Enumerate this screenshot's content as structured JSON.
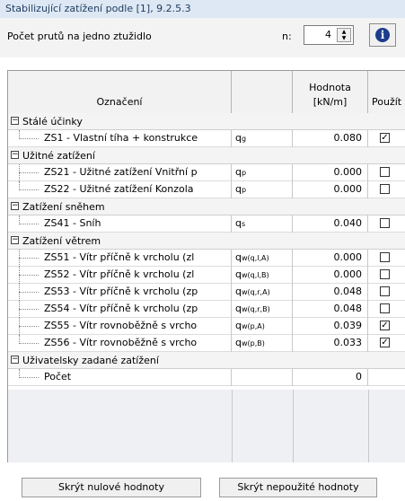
{
  "header": {
    "title": "Stabilizující zatížení podle [1], 9.2.5.3"
  },
  "params": {
    "rods_label": "Počet prutů na jedno ztužidlo",
    "n_label": "n:",
    "n_value": "4",
    "info_icon": "i"
  },
  "columns": {
    "name": "Označení",
    "value_line1": "Hodnota",
    "value_line2": "[kN/m]",
    "use": "Použít"
  },
  "groups": [
    {
      "label": "Stálé účinky",
      "items": [
        {
          "name": "ZS1 - Vlastní tíha + konstrukce",
          "sym": "q",
          "sub": "g",
          "value": "0.080",
          "checked": true
        }
      ]
    },
    {
      "label": "Užitné zatížení",
      "items": [
        {
          "name": "ZS21 - Užitné zatížení Vnitřní p",
          "sym": "q",
          "sub": "p",
          "value": "0.000",
          "checked": false
        },
        {
          "name": "ZS22 - Užitné zatížení Konzola",
          "sym": "q",
          "sub": "p",
          "value": "0.000",
          "checked": false
        }
      ]
    },
    {
      "label": "Zatížení sněhem",
      "items": [
        {
          "name": "ZS41 - Sníh",
          "sym": "q",
          "sub": "s",
          "value": "0.040",
          "checked": false
        }
      ]
    },
    {
      "label": "Zatížení větrem",
      "items": [
        {
          "name": "ZS51 - Vítr příčně k vrcholu (zl",
          "sym": "q",
          "sub": "w(q,l,A)",
          "value": "0.000",
          "checked": false
        },
        {
          "name": "ZS52 - Vítr příčně k vrcholu (zl",
          "sym": "q",
          "sub": "w(q,l,B)",
          "value": "0.000",
          "checked": false
        },
        {
          "name": "ZS53 - Vítr příčně k vrcholu (zp",
          "sym": "q",
          "sub": "w(q,r,A)",
          "value": "0.048",
          "checked": false
        },
        {
          "name": "ZS54 - Vítr příčně k vrcholu (zp",
          "sym": "q",
          "sub": "w(q,r,B)",
          "value": "0.048",
          "checked": false
        },
        {
          "name": "ZS55 - Vítr rovnoběžně s vrcho",
          "sym": "q",
          "sub": "w(p,A)",
          "value": "0.039",
          "checked": true
        },
        {
          "name": "ZS56 - Vítr rovnoběžně s vrcho",
          "sym": "q",
          "sub": "w(p,B)",
          "value": "0.033",
          "checked": true
        }
      ]
    },
    {
      "label": "Uživatelsky zadané zatížení",
      "items": [
        {
          "name": "Počet",
          "sym": "",
          "sub": "",
          "value": "0",
          "checked": null
        }
      ]
    }
  ],
  "footer": {
    "hide_zero": "Skrýt nulové hodnoty",
    "hide_unused": "Skrýt nepoužité hodnoty"
  },
  "icons": {
    "collapse": "minus-square-icon",
    "info": "info-icon",
    "spin": "spinner-arrows-icon",
    "check": "checkbox-icon"
  }
}
